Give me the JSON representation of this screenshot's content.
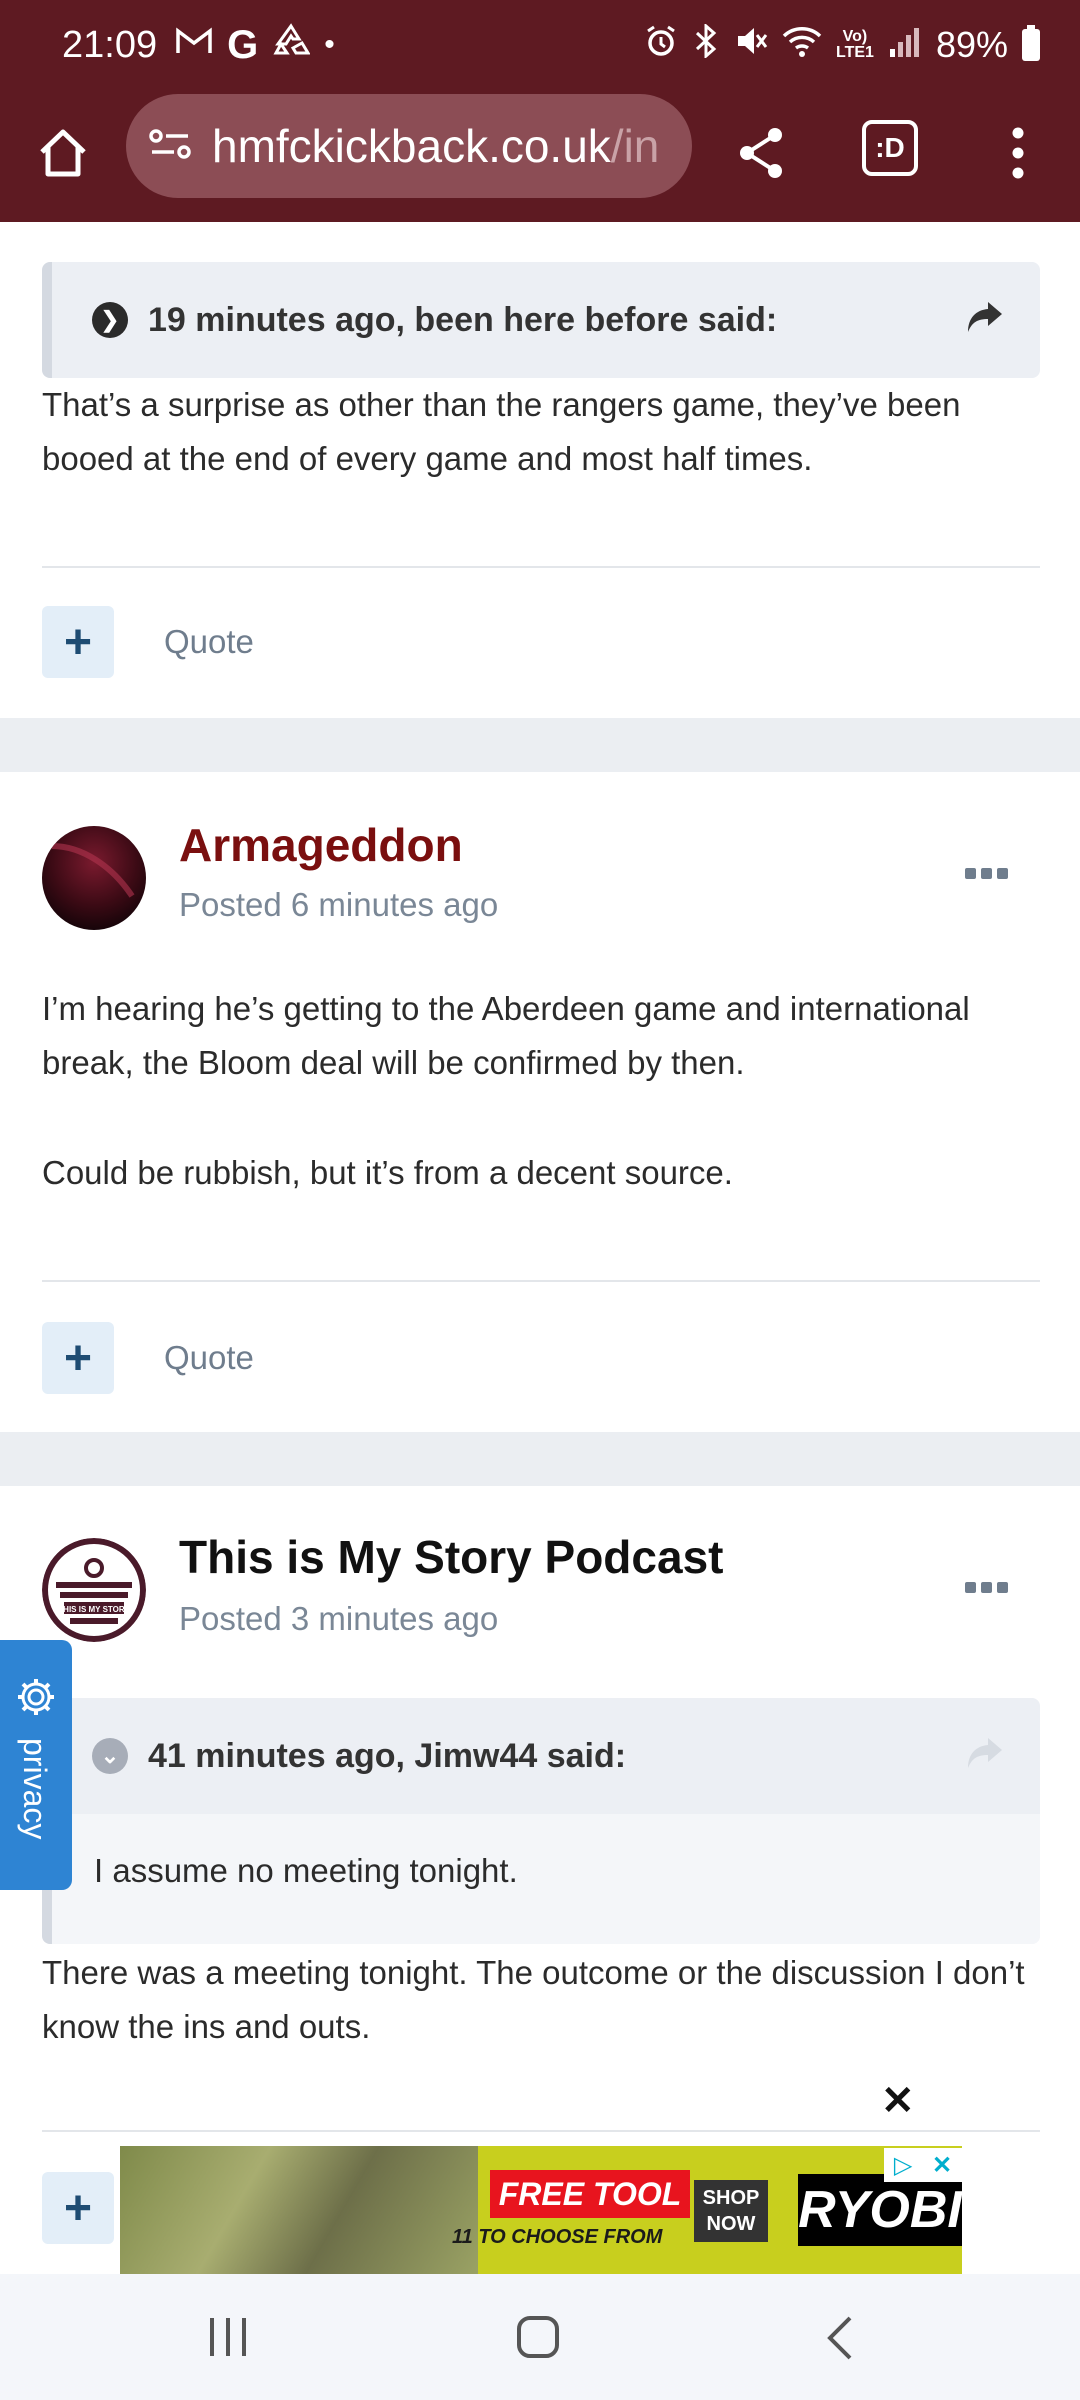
{
  "status_bar": {
    "time": "21:09",
    "notif_icons": [
      "gmail-icon",
      "google-icon",
      "recycle-icon"
    ],
    "battery": "89%"
  },
  "browser": {
    "url_main": "hmfckickback.co.uk",
    "url_rest": "/in",
    "tab_badge": ":D"
  },
  "posts": [
    {
      "quote": {
        "header": "19 minutes ago, been here before said:"
      },
      "text": "That’s a surprise as other than the rangers game, they’ve been booed at the end of every game and most half times.",
      "quote_label": "Quote"
    },
    {
      "author": "Armageddon",
      "author_color": "#7a0f0f",
      "posted": "Posted 6 minutes ago",
      "paragraphs": [
        "I’m hearing he’s getting to the Aberdeen game and international break, the Bloom deal will be confirmed by then.",
        "Could be rubbish, but it’s from a decent source."
      ],
      "quote_label": "Quote"
    },
    {
      "author": "This is My Story Podcast",
      "author_color": "#111111",
      "avatar_text": "THIS IS MY STORY",
      "posted": "Posted 3 minutes ago",
      "quote": {
        "header": "41 minutes ago, Jimw44 said:",
        "body": "I assume no meeting tonight."
      },
      "text": "There was a meeting tonight. The outcome or the discussion I don’t know the ins and outs."
    }
  ],
  "privacy": {
    "label": "privacy"
  },
  "ad": {
    "free_text": "FREE TOOL",
    "sub_text": "11 TO CHOOSE FROM",
    "shop_line1": "SHOP",
    "shop_line2": "NOW",
    "brand": "RYOBI"
  }
}
